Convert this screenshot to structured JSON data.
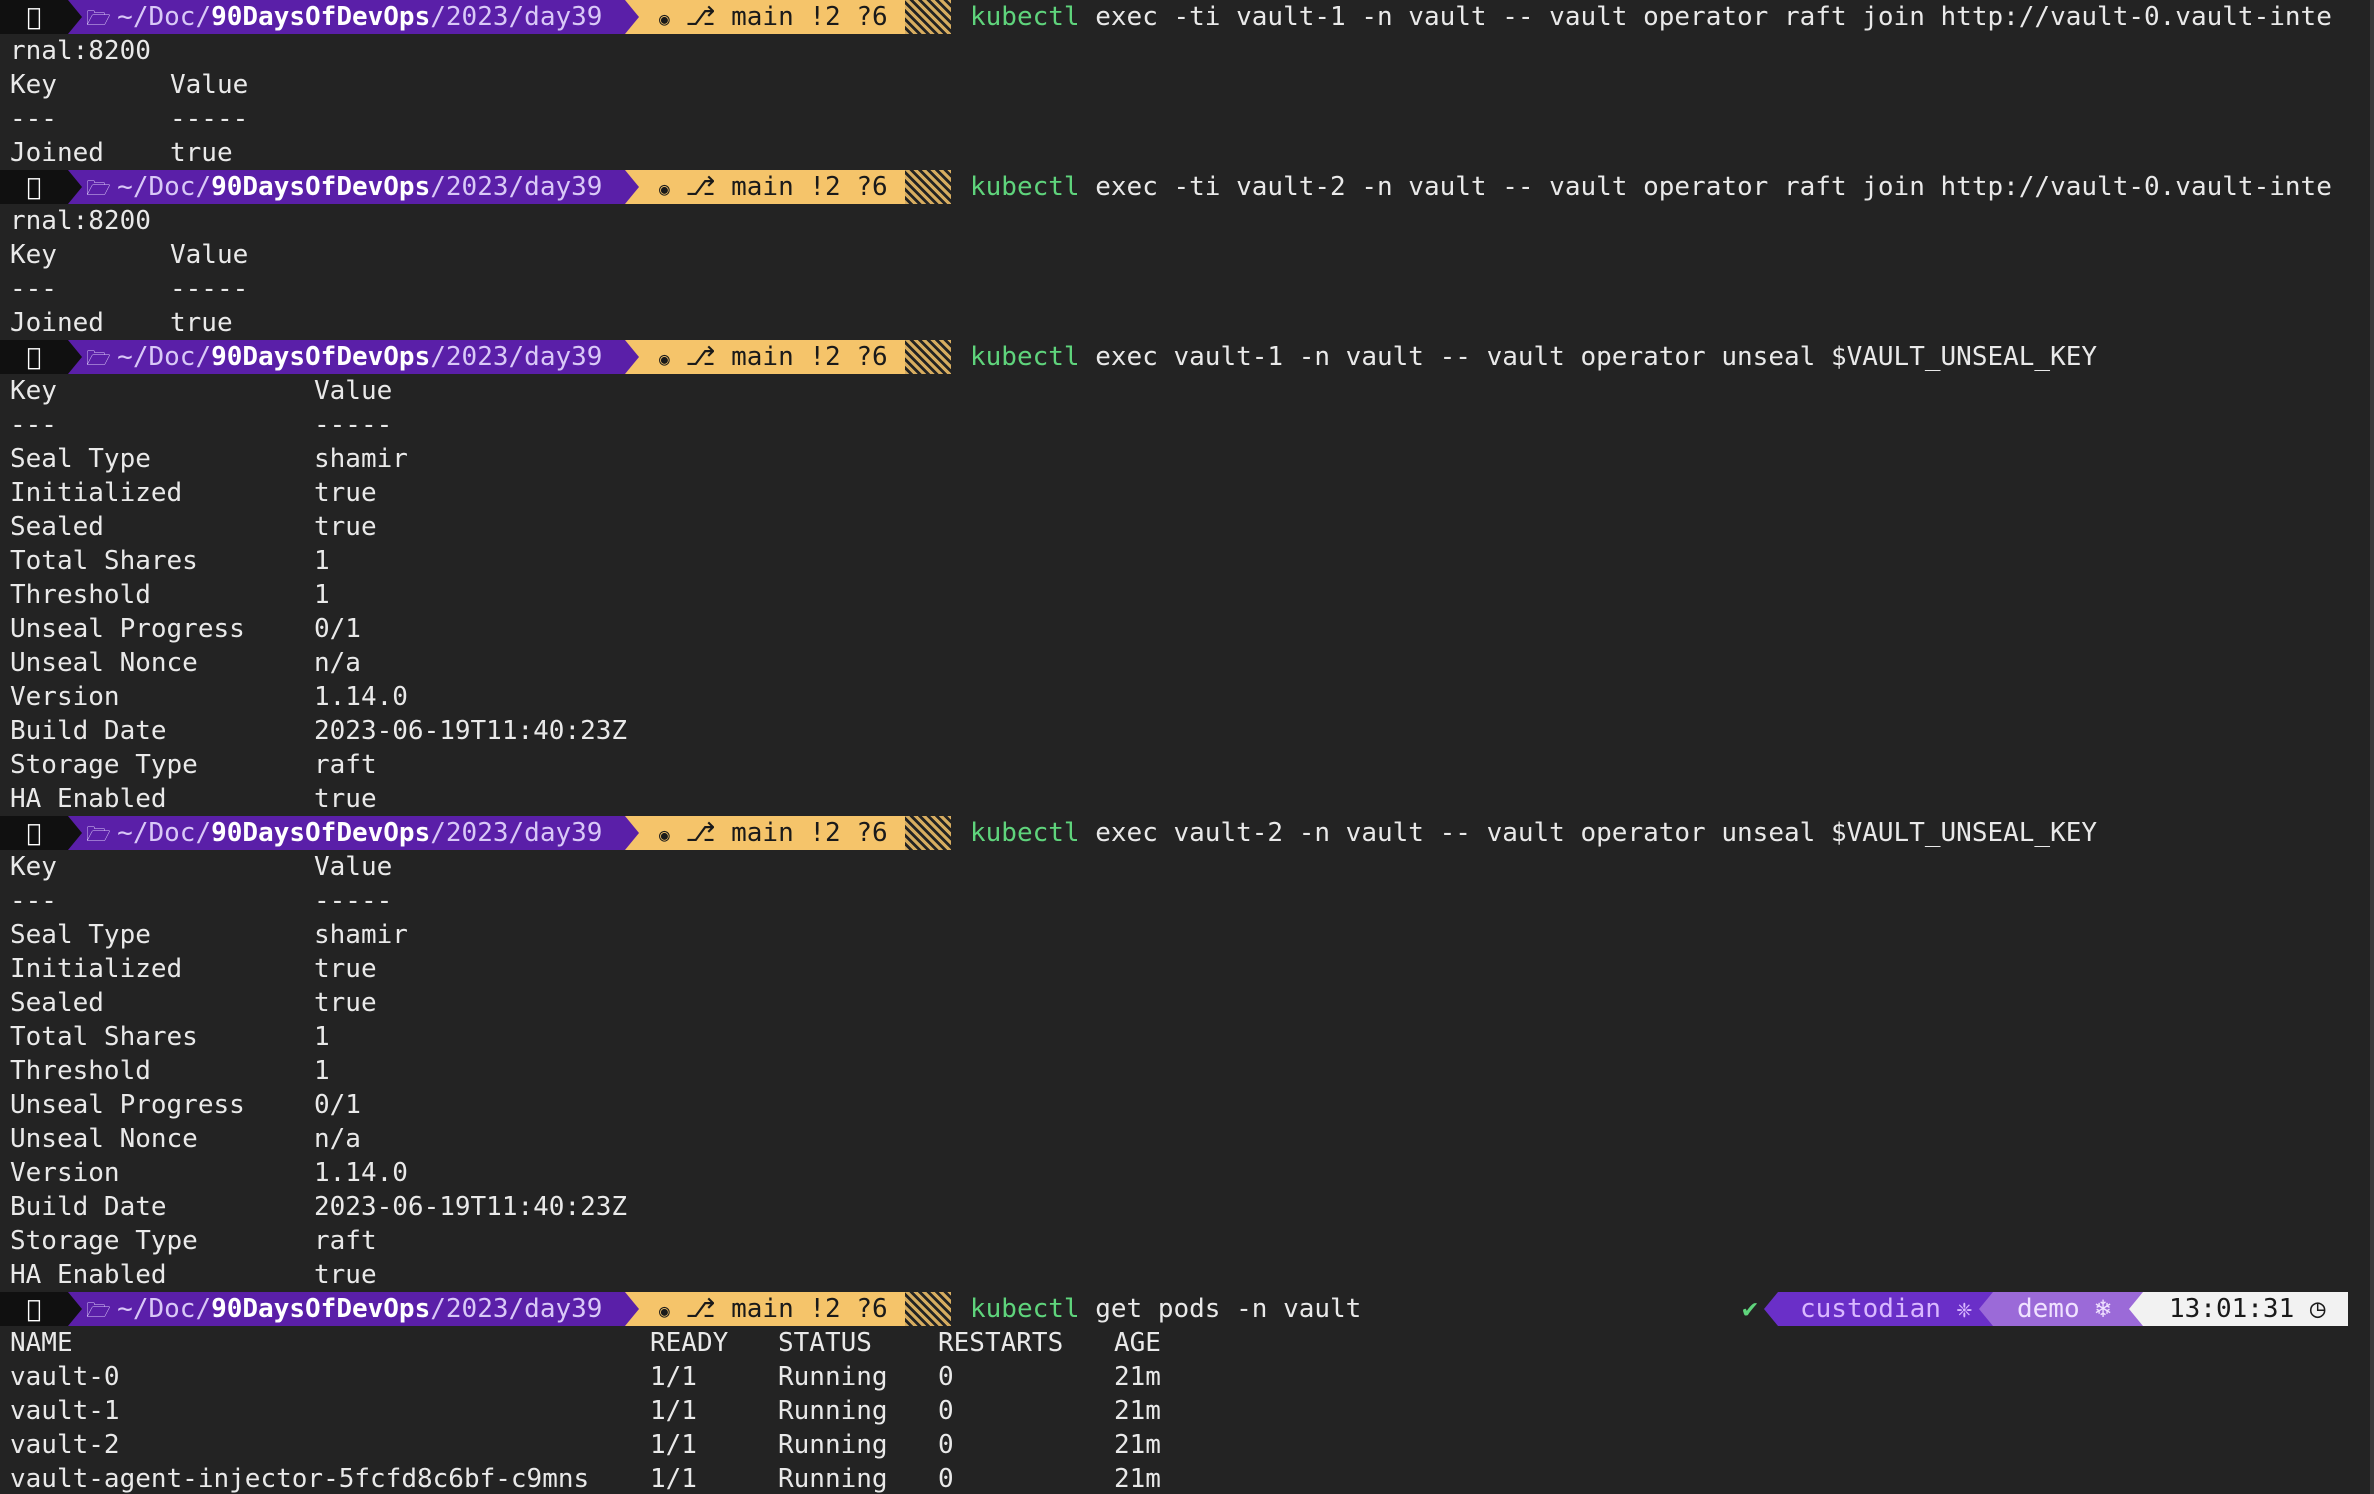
{
  "prompt": {
    "os_icon": "apple-icon",
    "folder_icon": "folder-icon",
    "dir_prefix": "~/Doc/",
    "dir_bold": "90DaysOfDevOps",
    "dir_suffix": "/2023/day39",
    "git_icon": "github-icon",
    "branch_icon": "git-branch-icon",
    "git_status": "main !2 ?6",
    "colors": {
      "os_bg": "#101010",
      "dir_bg": "#5a1fa8",
      "git_bg": "#f5c46a",
      "command_keyword": "#5fd47c"
    }
  },
  "blocks": [
    {
      "command_keyword": "kubectl",
      "command_rest": " exec -ti vault-1 -n vault -- vault operator raft join http://vault-0.vault-inte",
      "wrap": "rnal:8200",
      "output": [
        {
          "key": "Key",
          "value": "Value"
        },
        {
          "key": "---",
          "value": "-----"
        },
        {
          "key": "Joined",
          "value": "true"
        }
      ]
    },
    {
      "command_keyword": "kubectl",
      "command_rest": " exec -ti vault-2 -n vault -- vault operator raft join http://vault-0.vault-inte",
      "wrap": "rnal:8200",
      "output": [
        {
          "key": "Key",
          "value": "Value"
        },
        {
          "key": "---",
          "value": "-----"
        },
        {
          "key": "Joined",
          "value": "true"
        }
      ]
    },
    {
      "command_keyword": "kubectl",
      "command_rest": " exec vault-1 -n vault -- vault operator unseal $VAULT_UNSEAL_KEY",
      "output": [
        {
          "key": "Key",
          "value": "Value"
        },
        {
          "key": "---",
          "value": "-----"
        },
        {
          "key": "Seal Type",
          "value": "shamir"
        },
        {
          "key": "Initialized",
          "value": "true"
        },
        {
          "key": "Sealed",
          "value": "true"
        },
        {
          "key": "Total Shares",
          "value": "1"
        },
        {
          "key": "Threshold",
          "value": "1"
        },
        {
          "key": "Unseal Progress",
          "value": "0/1"
        },
        {
          "key": "Unseal Nonce",
          "value": "n/a"
        },
        {
          "key": "Version",
          "value": "1.14.0"
        },
        {
          "key": "Build Date",
          "value": "2023-06-19T11:40:23Z"
        },
        {
          "key": "Storage Type",
          "value": "raft"
        },
        {
          "key": "HA Enabled",
          "value": "true"
        }
      ]
    },
    {
      "command_keyword": "kubectl",
      "command_rest": " exec vault-2 -n vault -- vault operator unseal $VAULT_UNSEAL_KEY",
      "output": [
        {
          "key": "Key",
          "value": "Value"
        },
        {
          "key": "---",
          "value": "-----"
        },
        {
          "key": "Seal Type",
          "value": "shamir"
        },
        {
          "key": "Initialized",
          "value": "true"
        },
        {
          "key": "Sealed",
          "value": "true"
        },
        {
          "key": "Total Shares",
          "value": "1"
        },
        {
          "key": "Threshold",
          "value": "1"
        },
        {
          "key": "Unseal Progress",
          "value": "0/1"
        },
        {
          "key": "Unseal Nonce",
          "value": "n/a"
        },
        {
          "key": "Version",
          "value": "1.14.0"
        },
        {
          "key": "Build Date",
          "value": "2023-06-19T11:40:23Z"
        },
        {
          "key": "Storage Type",
          "value": "raft"
        },
        {
          "key": "HA Enabled",
          "value": "true"
        }
      ]
    }
  ],
  "last": {
    "command_keyword": "kubectl",
    "command_rest": " get pods -n vault",
    "right_prompt": {
      "status_icon": "check-icon",
      "status_glyph": "✔",
      "kube_context": "custodian",
      "kube_context_icon": "kubernetes-icon",
      "kube_namespace": "demo",
      "kube_namespace_icon": "snowflake-icon",
      "time": "13:01:31",
      "clock_icon": "clock-icon"
    },
    "pods": {
      "headers": [
        "NAME",
        "READY",
        "STATUS",
        "RESTARTS",
        "AGE"
      ],
      "rows": [
        [
          "vault-0",
          "1/1",
          "Running",
          "0",
          "21m"
        ],
        [
          "vault-1",
          "1/1",
          "Running",
          "0",
          "21m"
        ],
        [
          "vault-2",
          "1/1",
          "Running",
          "0",
          "21m"
        ],
        [
          "vault-agent-injector-5fcfd8c6bf-c9mns",
          "1/1",
          "Running",
          "0",
          "21m"
        ]
      ]
    }
  }
}
